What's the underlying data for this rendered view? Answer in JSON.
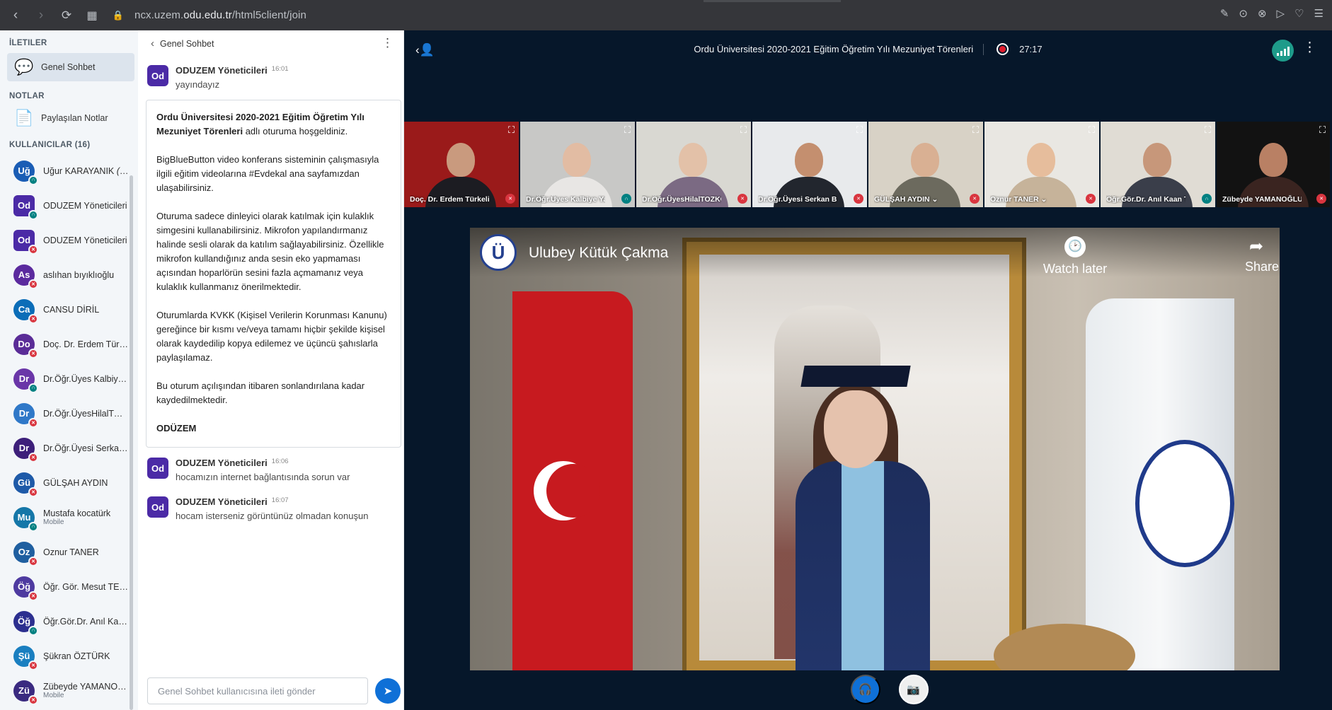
{
  "browser": {
    "url_prefix": "ncx.uzem.",
    "url_domain": "odu.edu.tr",
    "url_path": "/html5client/join",
    "back_icon": "‹",
    "forward_icon": "›",
    "reload_icon": "⟳",
    "grid_icon": "▦",
    "lock_icon": "🔒",
    "right_icons": [
      "✎",
      "⊙",
      "⊗",
      "▷",
      "♡",
      "☰"
    ]
  },
  "sidebar": {
    "messages_header": "İLETILER",
    "public_chat_label": "Genel Sohbet",
    "notes_header": "NOTLAR",
    "shared_notes_label": "Paylaşılan Notlar",
    "users_header": "KULLANICILAR (16)",
    "users": [
      {
        "initials": "Uğ",
        "name": "Uğur KARAYANIK",
        "suffix": "(Siz)",
        "color": "#1a5db5",
        "badge": "hp",
        "round": true,
        "sub": ""
      },
      {
        "initials": "Od",
        "name": "ODUZEM Yöneticileri",
        "suffix": "",
        "color": "#4b2aa6",
        "badge": "hp",
        "round": false,
        "sub": ""
      },
      {
        "initials": "Od",
        "name": "ODUZEM Yöneticileri",
        "suffix": "",
        "color": "#4b2aa6",
        "badge": "mic",
        "round": false,
        "sub": ""
      },
      {
        "initials": "As",
        "name": "aslıhan bıyıklıoğlu",
        "suffix": "",
        "color": "#5b2a9e",
        "badge": "mic",
        "round": true,
        "sub": ""
      },
      {
        "initials": "Ca",
        "name": "CANSU DİRİL",
        "suffix": "",
        "color": "#0b6db8",
        "badge": "mic",
        "round": true,
        "sub": ""
      },
      {
        "initials": "Do",
        "name": "Doç. Dr. Erdem Türkeli",
        "suffix": "",
        "color": "#5a2c97",
        "badge": "mic",
        "round": true,
        "sub": ""
      },
      {
        "initials": "Dr",
        "name": "Dr.Öğr.Üyes Kalbiye Yalazı",
        "suffix": "",
        "color": "#6a36a8",
        "badge": "hp",
        "round": true,
        "sub": ""
      },
      {
        "initials": "Dr",
        "name": "Dr.Öğr.ÜyesHilalTOZKOPARAN",
        "suffix": "",
        "color": "#2f78c8",
        "badge": "mic",
        "round": true,
        "sub": ""
      },
      {
        "initials": "Dr",
        "name": "Dr.Öğr.Üyesi Serkan Bilgiç",
        "suffix": "",
        "color": "#3d1f7a",
        "badge": "mic",
        "round": true,
        "sub": ""
      },
      {
        "initials": "Gü",
        "name": "GÜLŞAH AYDIN",
        "suffix": "",
        "color": "#1e5aa8",
        "badge": "mic",
        "round": true,
        "sub": ""
      },
      {
        "initials": "Mu",
        "name": "Mustafa kocatürk",
        "suffix": "",
        "color": "#1577a8",
        "badge": "hp",
        "round": true,
        "sub": "Mobile"
      },
      {
        "initials": "Oz",
        "name": "Oznur TANER",
        "suffix": "",
        "color": "#1f5fa0",
        "badge": "mic",
        "round": true,
        "sub": ""
      },
      {
        "initials": "Öğ",
        "name": "Öğr. Gör. Mesut TEMEL",
        "suffix": "",
        "color": "#4e3aa0",
        "badge": "mic",
        "round": true,
        "sub": ""
      },
      {
        "initials": "Öğ",
        "name": "Öğr.Gör.Dr. Anıl Kaan TEMEL",
        "suffix": "",
        "color": "#2c2f8f",
        "badge": "hp",
        "round": true,
        "sub": ""
      },
      {
        "initials": "Şü",
        "name": "Şükran ÖZTÜRK",
        "suffix": "",
        "color": "#1a7fc0",
        "badge": "mic",
        "round": true,
        "sub": ""
      },
      {
        "initials": "Zü",
        "name": "Zübeyde YAMANOĞLU",
        "suffix": "",
        "color": "#3a2a80",
        "badge": "mic",
        "round": true,
        "sub": "Mobile"
      }
    ]
  },
  "chat": {
    "title": "Genel Sohbet",
    "back_icon": "‹",
    "menu_icon": "⋮",
    "messages_before": [
      {
        "initials": "Od",
        "name": "ODUZEM Yöneticileri",
        "time": "16:01",
        "text": "yayındayız"
      }
    ],
    "welcome": {
      "p1_bold": "Ordu Üniversitesi 2020-2021 Eğitim Öğretim Yılı Mezuniyet Törenleri",
      "p1_rest": " adlı oturuma hoşgeldiniz.",
      "p2": "BigBlueButton video konferans sisteminin çalışmasıyla ilgili eğitim videolarına #Evdekal ana sayfamızdan ulaşabilirsiniz.",
      "p3": "Oturuma sadece dinleyici olarak katılmak için kulaklık simgesini kullanabilirsiniz. Mikrofon yapılandırmanız halinde sesli olarak da katılım sağlayabilirsiniz. Özellikle mikrofon kullandığınız anda sesin eko yapmaması açısından hoparlörün sesini fazla açmamanız veya kulaklık kullanmanız önerilmektedir.",
      "p4": "Oturumlarda KVKK (Kişisel Verilerin Korunması Kanunu) gereğince bir kısmı ve/veya tamamı hiçbir şekilde kişisel olarak kaydedilip kopya edilemez ve üçüncü şahıslarla paylaşılamaz.",
      "p5": "Bu oturum açılışından itibaren sonlandırılana kadar kaydedilmektedir.",
      "p6": "ODÜZEM"
    },
    "messages_after": [
      {
        "initials": "Od",
        "name": "ODUZEM Yöneticileri",
        "time": "16:06",
        "text": "hocamızın internet bağlantısında sorun var"
      },
      {
        "initials": "Od",
        "name": "ODUZEM Yöneticileri",
        "time": "16:07",
        "text": "hocam isterseniz görüntünüz olmadan konuşun"
      }
    ],
    "input_placeholder": "Genel Sohbet kullanıcısına ileti gönder",
    "send_icon": "➤"
  },
  "session": {
    "title": "Ordu Üniversitesi 2020-2021 Eğitim Öğretim Yılı Mezuniyet Törenleri",
    "timer": "27:17",
    "toggle_icon": "‹👤",
    "options_icon": "⋮"
  },
  "webcams": [
    {
      "label": "Doç. Dr. Erdem Türkeli",
      "badge": "mic",
      "wall": "#9a1a1a",
      "face": "#c99a7e",
      "body": "#1c1c22"
    },
    {
      "label": "Dr.Öğr.Üyes Kalbiye Yalazı",
      "badge": "hp",
      "wall": "#c8c8c6",
      "face": "#e2bca3",
      "body": "#e8e6e4"
    },
    {
      "label": "Dr.Öğr.ÜyesHilalTOZKOPARAN",
      "badge": "mic",
      "wall": "#d9d8d2",
      "face": "#e3c1a8",
      "body": "#7b6a83"
    },
    {
      "label": "Dr.Öğr.Üyesi Serkan Bilgiç",
      "badge": "mic",
      "wall": "#e8eaec",
      "face": "#c48f6f",
      "body": "#22262e"
    },
    {
      "label": "GÜLŞAH AYDIN",
      "badge": "mic",
      "wall": "#d8d2c6",
      "face": "#d9b093",
      "body": "#6c6a5e"
    },
    {
      "label": "Oznur TANER",
      "badge": "mic",
      "wall": "#e9e7e2",
      "face": "#e6bd9c",
      "body": "#c6b39a"
    },
    {
      "label": "Öğr.Gör.Dr. Anıl Kaan TEMEL",
      "badge": "hp",
      "wall": "#e0dcd4",
      "face": "#c7977a",
      "body": "#3a3e4a"
    },
    {
      "label": "Zübeyde YAMANOĞLU",
      "badge": "mic",
      "wall": "#121212",
      "face": "#b98064",
      "body": "#3a2420"
    }
  ],
  "shared_video": {
    "channel_title": "Ulubey Kütük Çakma",
    "channel_logo": "Ü",
    "watch_later": "Watch later",
    "watch_icon": "🕑",
    "share": "Share",
    "share_icon": "➦"
  },
  "controls": {
    "audio_icon": "🎧",
    "video_icon": "📷"
  },
  "colors": {
    "primary": "#0f70d7",
    "background": "#06172a",
    "mic_muted": "#d9353f",
    "listen_only": "#008081"
  }
}
